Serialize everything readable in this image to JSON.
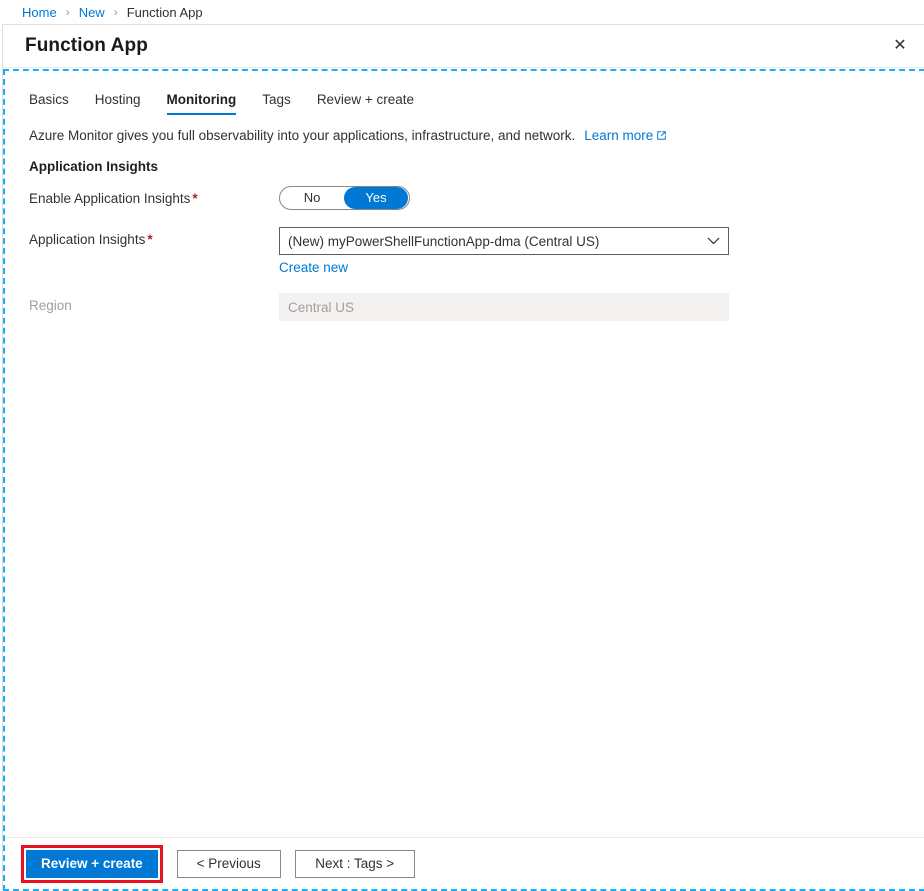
{
  "breadcrumb": {
    "items": [
      {
        "label": "Home",
        "type": "link"
      },
      {
        "label": "New",
        "type": "link"
      },
      {
        "label": "Function App",
        "type": "current"
      }
    ],
    "separator": "›"
  },
  "blade": {
    "title": "Function App",
    "close_icon": "✕"
  },
  "tabs": [
    {
      "label": "Basics",
      "selected": false
    },
    {
      "label": "Hosting",
      "selected": false
    },
    {
      "label": "Monitoring",
      "selected": true
    },
    {
      "label": "Tags",
      "selected": false
    },
    {
      "label": "Review + create",
      "selected": false
    }
  ],
  "description": {
    "text": "Azure Monitor gives you full observability into your applications, infrastructure, and network.",
    "link_label": "Learn more"
  },
  "section": {
    "heading": "Application Insights",
    "enable_label": "Enable Application Insights",
    "toggle": {
      "off_label": "No",
      "on_label": "Yes",
      "value": "Yes"
    },
    "app_insights_label": "Application Insights",
    "app_insights_value": "(New) myPowerShellFunctionApp-dma (Central US)",
    "create_new_label": "Create new",
    "region_label": "Region",
    "region_value": "Central US",
    "required_marker": "*"
  },
  "footer": {
    "review_create_label": "Review + create",
    "previous_label": "< Previous",
    "next_label": "Next : Tags >"
  },
  "colors": {
    "accent": "#0078d4",
    "required": "#a4262c",
    "highlight": "#e81123",
    "dashed_region": "#1ab0f4"
  }
}
